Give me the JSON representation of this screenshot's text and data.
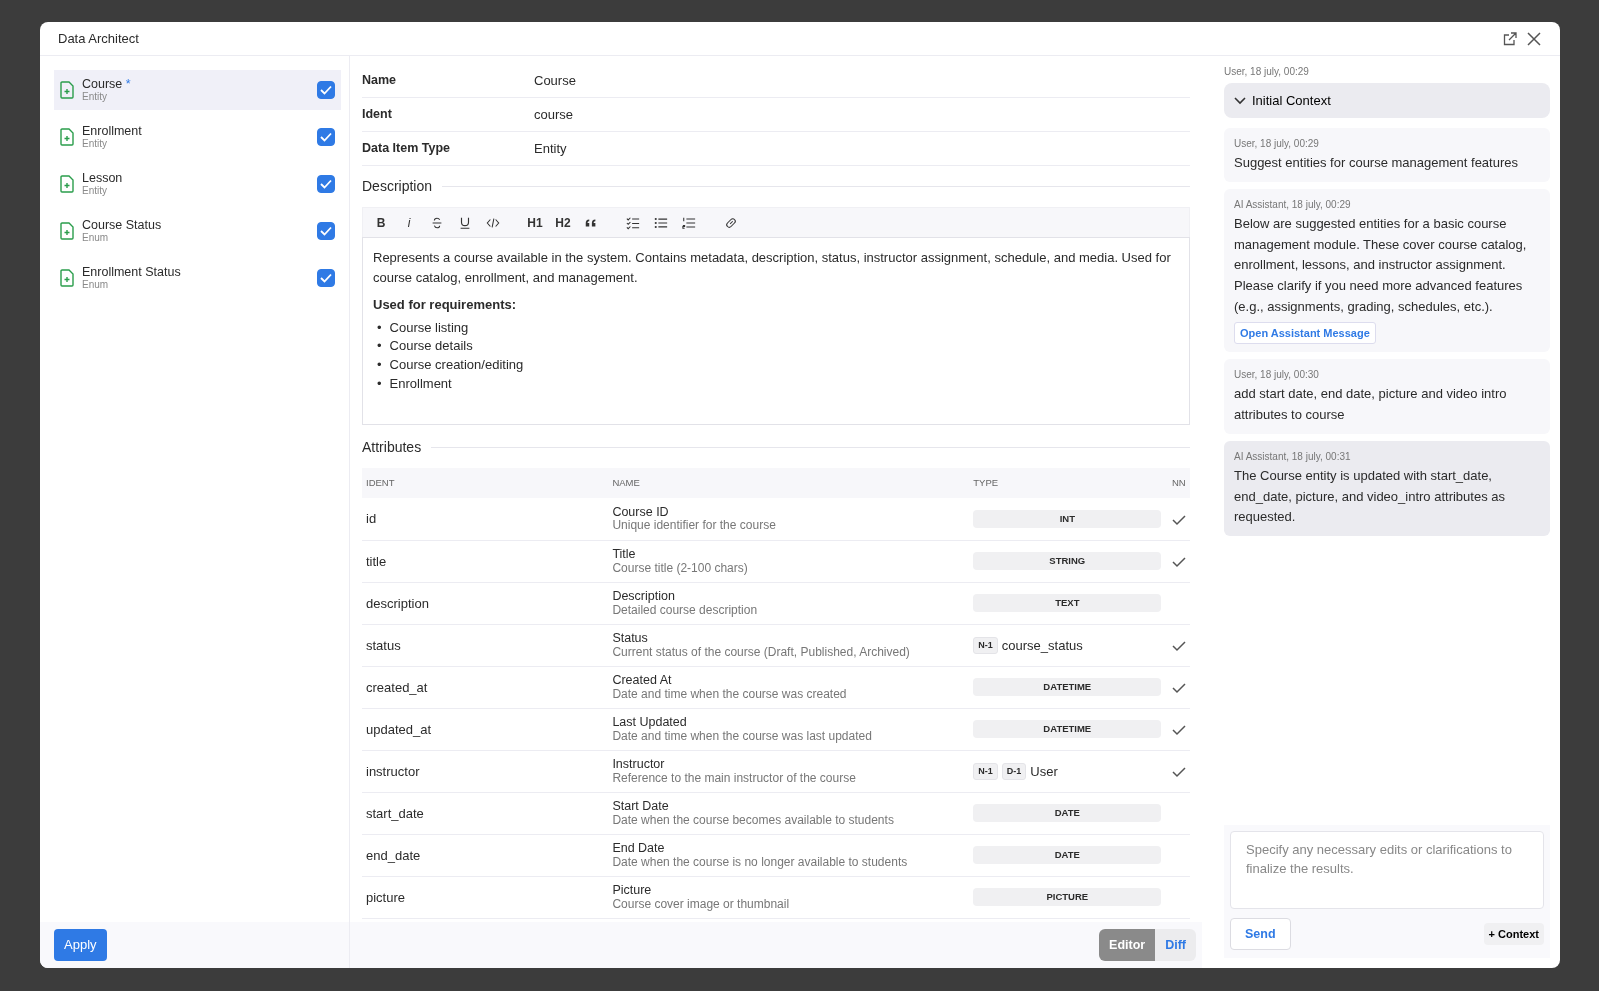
{
  "dialog": {
    "title": "Data Architect"
  },
  "items": [
    {
      "name": "Course",
      "marker": "*",
      "type": "Entity",
      "checked": true,
      "selected": true
    },
    {
      "name": "Enrollment",
      "type": "Entity",
      "checked": true,
      "selected": false
    },
    {
      "name": "Lesson",
      "type": "Entity",
      "checked": true,
      "selected": false
    },
    {
      "name": "Course Status",
      "type": "Enum",
      "checked": true,
      "selected": false
    },
    {
      "name": "Enrollment Status",
      "type": "Enum",
      "checked": true,
      "selected": false
    }
  ],
  "details": {
    "fields": [
      {
        "label": "Name",
        "value": "Course"
      },
      {
        "label": "Ident",
        "value": "course"
      },
      {
        "label": "Data Item Type",
        "value": "Entity"
      }
    ],
    "description_heading": "Description",
    "toolbar": [
      [
        {
          "kind": "text",
          "label": "B"
        },
        {
          "kind": "text",
          "label": "i"
        },
        {
          "kind": "strike"
        },
        {
          "kind": "underline"
        },
        {
          "kind": "code"
        }
      ],
      [
        {
          "kind": "text",
          "label": "H1"
        },
        {
          "kind": "text",
          "label": "H2"
        },
        {
          "kind": "quote"
        }
      ],
      [
        {
          "kind": "tasks"
        },
        {
          "kind": "bullets"
        },
        {
          "kind": "numbers"
        }
      ],
      [
        {
          "kind": "link"
        }
      ]
    ],
    "description": {
      "paragraph": "Represents a course available in the system. Contains metadata, description, status, instructor assignment, schedule, and media. Used for course catalog, enrollment, and management.",
      "subheading": "Used for requirements:",
      "list": [
        {
          "bullet": "•",
          "text": "Course listing"
        },
        {
          "bullet": "•",
          "text": "Course details"
        },
        {
          "bullet": "•",
          "text": "Course creation/editing"
        },
        {
          "bullet": "•",
          "text": "Enrollment"
        }
      ]
    },
    "attributes_heading": "Attributes",
    "columns": [
      "IDENT",
      "NAME",
      "TYPE",
      "NN"
    ],
    "rows": [
      {
        "ident": "id",
        "name": "Course ID",
        "description": "Unique identifier for the course",
        "type": {
          "kind": "badge",
          "label": "INT"
        },
        "not_null": true
      },
      {
        "ident": "title",
        "name": "Title",
        "description": "Course title (2-100 chars)",
        "type": {
          "kind": "badge",
          "label": "STRING"
        },
        "not_null": true
      },
      {
        "ident": "description",
        "name": "Description",
        "description": "Detailed course description",
        "type": {
          "kind": "badge",
          "label": "TEXT"
        },
        "not_null": false
      },
      {
        "ident": "status",
        "name": "Status",
        "description": "Current status of the course (Draft, Published, Archived)",
        "type": {
          "kind": "relation",
          "tags": [
            "N-1"
          ],
          "target": "course_status"
        },
        "not_null": true
      },
      {
        "ident": "created_at",
        "name": "Created At",
        "description": "Date and time when the course was created",
        "type": {
          "kind": "badge",
          "label": "DATETIME"
        },
        "not_null": true
      },
      {
        "ident": "updated_at",
        "name": "Last Updated",
        "description": "Date and time when the course was last updated",
        "type": {
          "kind": "badge",
          "label": "DATETIME"
        },
        "not_null": true
      },
      {
        "ident": "instructor",
        "name": "Instructor",
        "description": "Reference to the main instructor of the course",
        "type": {
          "kind": "relation",
          "tags": [
            "N-1",
            "D-1"
          ],
          "target": "User"
        },
        "not_null": true
      },
      {
        "ident": "start_date",
        "name": "Start Date",
        "description": "Date when the course becomes available to students",
        "type": {
          "kind": "badge",
          "label": "DATE"
        },
        "not_null": false
      },
      {
        "ident": "end_date",
        "name": "End Date",
        "description": "Date when the course is no longer available to students",
        "type": {
          "kind": "badge",
          "label": "DATE"
        },
        "not_null": false
      },
      {
        "ident": "picture",
        "name": "Picture",
        "description": "Course cover image or thumbnail",
        "type": {
          "kind": "badge",
          "label": "PICTURE"
        },
        "not_null": false
      }
    ]
  },
  "footer": {
    "apply": "Apply",
    "views": [
      {
        "label": "Editor",
        "selected": true
      },
      {
        "label": "Diff",
        "selected": false
      }
    ]
  },
  "chat": {
    "messages": [
      {
        "kind": "context",
        "meta": "User, 18 july, 00:29",
        "label": "Initial Context",
        "expanded": false
      },
      {
        "kind": "message",
        "meta": "User, 18 july, 00:29",
        "text": "Suggest entities for course management features",
        "selected": false
      },
      {
        "kind": "message",
        "meta": "AI Assistant, 18 july, 00:29",
        "text": "Below are suggested entities for a basic course management module. These cover course catalog, enrollment, lessons, and instructor assignment. Please clarify if you need more advanced features (e.g., assignments, grading, schedules, etc.).",
        "link": "Open Assistant Message",
        "selected": false
      },
      {
        "kind": "message",
        "meta": "User, 18 july, 00:30",
        "text": "add start date, end date, picture and video intro attributes to course",
        "selected": false
      },
      {
        "kind": "message",
        "meta": "AI Assistant, 18 july, 00:31",
        "text": "The Course entity is updated with start_date, end_date, picture, and video_intro attributes as requested.",
        "selected": true
      }
    ],
    "placeholder": "Specify any necessary edits or clarifications to finalize the results.",
    "send": "Send",
    "context_button": "+ Context"
  }
}
